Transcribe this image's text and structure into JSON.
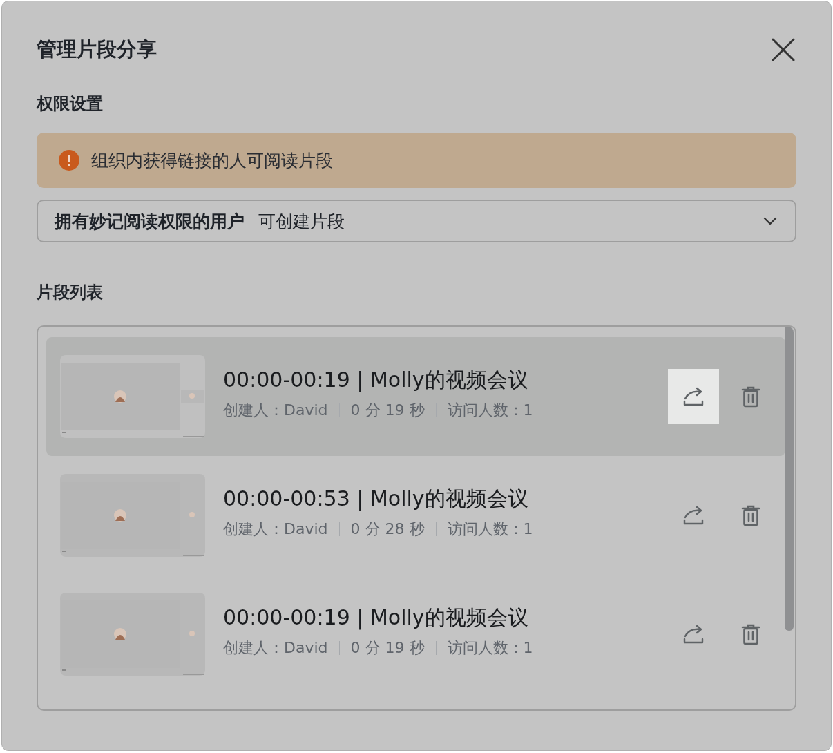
{
  "dialog": {
    "title": "管理片段分享"
  },
  "permissions": {
    "heading": "权限设置",
    "alert": "组织内获得链接的人可阅读片段",
    "select": {
      "label": "拥有妙记阅读权限的用户",
      "value": "可创建片段"
    }
  },
  "clips_heading": "片段列表",
  "clips": [
    {
      "title": "00:00-00:19 | Molly的视频会议",
      "creator": "创建人：David",
      "duration": "0 分 19 秒",
      "visitors": "访问人数：1",
      "selected": true,
      "share_active": true
    },
    {
      "title": "00:00-00:53 | Molly的视频会议",
      "creator": "创建人：David",
      "duration": "0 分 28 秒",
      "visitors": "访问人数：1",
      "selected": false,
      "share_active": false
    },
    {
      "title": "00:00-00:19 | Molly的视频会议",
      "creator": "创建人：David",
      "duration": "0 分 19 秒",
      "visitors": "访问人数：1",
      "selected": false,
      "share_active": false
    }
  ]
}
